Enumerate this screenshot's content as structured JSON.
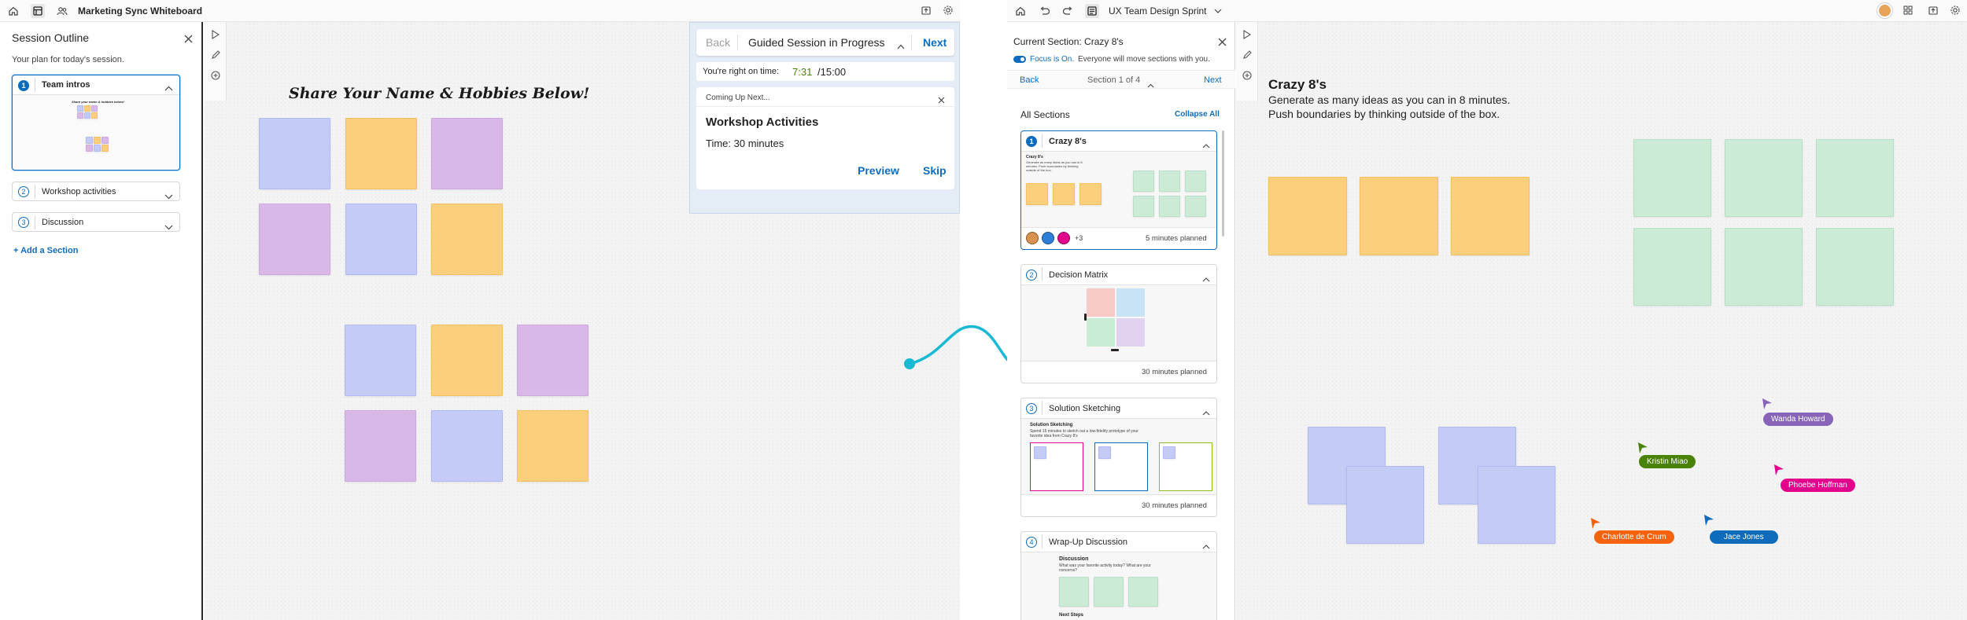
{
  "left_window": {
    "title": "Marketing Sync Whiteboard",
    "outline": {
      "heading": "Session Outline",
      "subtitle": "Your plan for today's session.",
      "sections": [
        {
          "num": "1",
          "label": "Team intros",
          "thumb_caption": "Share your name & hobbies below!"
        },
        {
          "num": "2",
          "label": "Workshop activities"
        },
        {
          "num": "3",
          "label": "Discussion"
        }
      ],
      "add_label": "+ Add a Section"
    },
    "canvas": {
      "board_title": "Share Your Name & Hobbies Below!"
    },
    "guided": {
      "back": "Back",
      "status": "Guided Session in Progress",
      "next": "Next",
      "timer_prefix": "You're right on time:",
      "timer_elapsed": "7:31",
      "timer_total": "/15:00",
      "coming_up": "Coming Up Next...",
      "card_title": "Workshop Activities",
      "card_time": "Time: 30 minutes",
      "preview": "Preview",
      "skip": "Skip"
    }
  },
  "right_window": {
    "title": "UX Team Design Sprint",
    "panel": {
      "current_section": "Current Section: Crazy 8's",
      "focus_label": "Focus is On.",
      "focus_desc": "Everyone will move sections with you.",
      "back": "Back",
      "section_counter": "Section 1 of 4",
      "next": "Next",
      "all_sections": "All Sections",
      "collapse_all": "Collapse All",
      "sections": [
        {
          "num": "1",
          "title": "Crazy 8's",
          "planned": "5 minutes planned",
          "extra_count": "+3",
          "thumb_title": "Crazy 8's",
          "thumb_desc": "Generate as many ideas as you can in 8 minutes. Push boundaries by thinking outside of the box."
        },
        {
          "num": "2",
          "title": "Decision Matrix",
          "planned": "30 minutes planned"
        },
        {
          "num": "3",
          "title": "Solution Sketching",
          "planned": "30 minutes planned",
          "thumb_title": "Solution Sketching",
          "thumb_desc": "Spend 15 minutes to sketch out a low-fidelity prototype of your favorite idea from Crazy 8's"
        },
        {
          "num": "4",
          "title": "Wrap-Up Discussion",
          "thumb_title": "Discussion",
          "thumb_desc": "What was your favorite activity today? What are your concerns?",
          "thumb_next": "Next Steps"
        }
      ]
    },
    "canvas": {
      "title": "Crazy 8's",
      "desc_line1": "Generate as many ideas as you can in 8 minutes.",
      "desc_line2": "Push boundaries by thinking outside of the box."
    },
    "cursors": [
      {
        "name": "Wanda Howard",
        "color": "#8764b8"
      },
      {
        "name": "Kristin Miao",
        "color": "#498205"
      },
      {
        "name": "Phoebe Hoffman",
        "color": "#e3008c"
      },
      {
        "name": "Charlotte de Crum",
        "color": "#f7630c"
      },
      {
        "name": "Jace Jones",
        "color": "#0f6cbd"
      }
    ]
  },
  "colors": {
    "accent": "#0f6cbd",
    "timer_green": "#498205",
    "connector": "#19b8d3"
  }
}
